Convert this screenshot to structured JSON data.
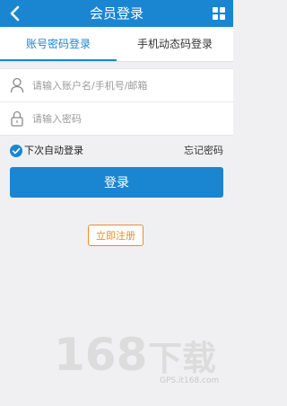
{
  "header": {
    "title": "会员登录"
  },
  "tabs": [
    {
      "label": "账号密码登录",
      "active": true
    },
    {
      "label": "手机动态码登录",
      "active": false
    }
  ],
  "form": {
    "account_placeholder": "请输入账户名/手机号/邮箱",
    "password_placeholder": "请输入密码"
  },
  "options": {
    "auto_login_label": "下次自动登录",
    "auto_login_checked": true,
    "forgot_label": "忘记密码"
  },
  "buttons": {
    "login_label": "登录",
    "register_label": "立即注册"
  },
  "watermark": {
    "logo": "168下载",
    "site": "GPS.it168.com"
  },
  "colors": {
    "primary": "#1a86d2",
    "accent": "#f08a28",
    "background": "#f0f0f2"
  }
}
